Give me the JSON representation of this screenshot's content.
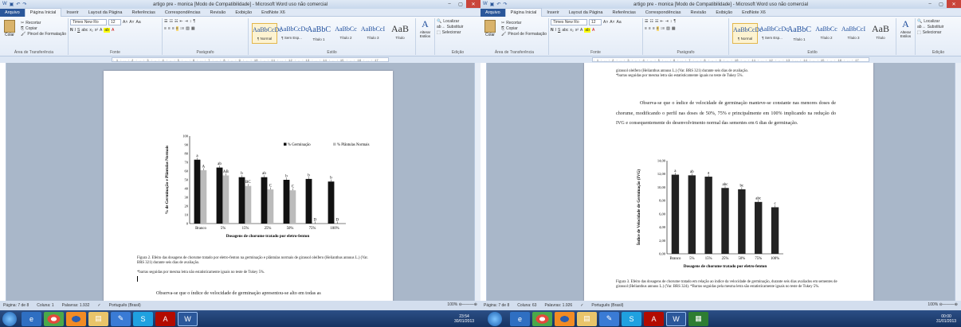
{
  "left": {
    "title": "artigo pre - monica [Modo de Compatibilidade] - Microsoft Word uso não comercial",
    "tabs": [
      "Arquivo",
      "Página Inicial",
      "Inserir",
      "Layout da Página",
      "Referências",
      "Correspondências",
      "Revisão",
      "Exibição",
      "EndNote X6"
    ],
    "clipboard": {
      "paste": "Colar",
      "cut": "Recortar",
      "copy": "Copiar",
      "painter": "Pincel de Formatação",
      "group": "Área de Transferência"
    },
    "font": {
      "name": "Times New Ro",
      "size": "12",
      "group": "Fonte"
    },
    "paragraph_group": "Parágrafo",
    "styles": [
      {
        "sample": "AaBbCcDc",
        "name": "¶ Normal"
      },
      {
        "sample": "AaBbCcDc",
        "name": "¶ Sem Esp..."
      },
      {
        "sample": "AaBbC",
        "name": "Título 1"
      },
      {
        "sample": "AaBbCc",
        "name": "Título 2"
      },
      {
        "sample": "AaBbCcI",
        "name": "Título 3"
      },
      {
        "sample": "AaB",
        "name": "Título"
      }
    ],
    "styles_group": "Estilo",
    "change_styles": "Alterar Estilos",
    "editing": {
      "find": "Localizar",
      "replace": "Substituir",
      "select": "Selecionar",
      "group": "Edição"
    },
    "figure_caption": "Figura 2. Efeito das dosagens de chorume tratado por eletro-fenton na germinação e plântulas normais de girassol oleífero (Helianthus annuus L.) (Var. BRS 321) durante seis dias de avaliação.",
    "figure_note": "*barras seguidas por mesma letra não estatisticamente iguais no teste de Tukey 5%.",
    "body_text": "Observa-se que o índice de velocidade de germinação apresentou-se alto em todas as",
    "status": {
      "page": "Página: 7 de 8",
      "column": "Coluna: 1",
      "words": "Palavras: 1.932",
      "lang": "Português (Brasil)",
      "zoom": "100%"
    },
    "clock": {
      "time": "23:54",
      "date": "30/01/2013"
    }
  },
  "right": {
    "title": "artigo pre - monica [Modo de Compatibilidade] - Microsoft Word uso não comercial",
    "top_caption": "girassol oleífero (Helianthus annuus L.) (Var. BRS 321) durante seis dias de avaliação.",
    "top_note": "*barras seguidas por mesma letra são estatisticamente iguais no teste de Tukey 5%.",
    "paragraph": "Observa-se que o índice de velocidade de germinação manteve-se constante nas menores doses de chorume, modificando o perfil nas doses de 50%, 75% e principalmente em 100% implicando na redução do IVG e consequentemente do desenvolvimento normal das sementes em 6 dias de germinação.",
    "figure_caption": "Figura 3. Efeito das dosagens de chorume tratado em relação ao índice da velocidade de germinação, durante seis dias avaliados em sementes de girassol (Helianthus annuus L.) (Var. BRS 324). *Barras seguidas pela mesma letra são estatisticamente iguais no teste de Tukey 5%.",
    "status": {
      "page": "Página: 7 de 8",
      "column": "Coluna: 63",
      "words": "Palavras: 1.926",
      "lang": "Português (Brasil)",
      "zoom": "100%"
    },
    "clock": {
      "time": "00:00",
      "date": "31/01/2013"
    }
  },
  "chart_data": [
    {
      "type": "bar",
      "categories": [
        "Branco",
        "5%",
        "15%",
        "25%",
        "50%",
        "75%",
        "100%"
      ],
      "series": [
        {
          "name": "% Germinação",
          "values": [
            73,
            64,
            53,
            53,
            50,
            51,
            48
          ],
          "letters": [
            "a",
            "ab",
            "b",
            "ab",
            "b",
            "b",
            "b"
          ],
          "color": "#111111"
        },
        {
          "name": "% Plântulas Normais",
          "values": [
            61,
            55,
            43,
            39,
            38,
            0,
            0
          ],
          "letters": [
            "A",
            "AB",
            "BC",
            "C",
            "C",
            "D",
            "D"
          ],
          "color": "#bbbbbb"
        }
      ],
      "ylabel": "% de Germinação e Plântulas Normais",
      "xlabel": "Dosagens de chorume tratado por eletro-fenton",
      "ylim": [
        0,
        100
      ],
      "yticks": [
        0,
        10,
        20,
        30,
        40,
        50,
        60,
        70,
        80,
        90,
        100
      ],
      "legend": "top-right"
    },
    {
      "type": "bar",
      "categories": [
        "Branco",
        "5%",
        "15%",
        "25%",
        "50%",
        "75%",
        "100%"
      ],
      "series": [
        {
          "values": [
            11.9,
            11.8,
            11.6,
            9.9,
            9.7,
            7.8,
            7.0
          ],
          "letters": [
            "a",
            "ab",
            "a",
            "abc",
            "bc",
            "abc",
            "c"
          ],
          "color": "#222222"
        }
      ],
      "ylabel": "Índice de Velocidade de Germinação (IVG)",
      "xlabel": "Dosagens de chorume tratado por eletro-fenton",
      "ylim": [
        0,
        14
      ],
      "yticks": [
        "0,00",
        "2,00",
        "4,00",
        "6,00",
        "8,00",
        "10,00",
        "12,00",
        "14,00"
      ]
    }
  ],
  "taskbar": [
    "ie-icon",
    "chrome-icon",
    "firefox-icon",
    "folder-icon",
    "paint-icon",
    "skype-icon",
    "acrobat-icon",
    "word-icon"
  ]
}
